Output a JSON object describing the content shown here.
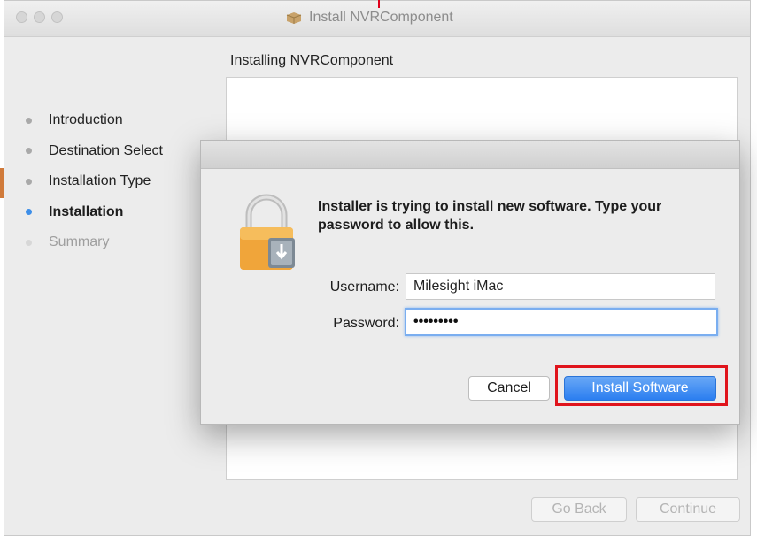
{
  "window": {
    "title": "Install NVRComponent",
    "section_title": "Installing NVRComponent"
  },
  "sidebar": {
    "items": [
      {
        "label": "Introduction",
        "state": "done"
      },
      {
        "label": "Destination Select",
        "state": "done"
      },
      {
        "label": "Installation Type",
        "state": "done"
      },
      {
        "label": "Installation",
        "state": "active"
      },
      {
        "label": "Summary",
        "state": "pending"
      }
    ]
  },
  "footer": {
    "go_back_label": "Go Back",
    "continue_label": "Continue"
  },
  "auth_dialog": {
    "message": "Installer is trying to install new software. Type your password to allow this.",
    "username_label": "Username:",
    "username_value": "Milesight iMac",
    "password_label": "Password:",
    "password_masked": "•••••••••",
    "cancel_label": "Cancel",
    "install_label": "Install Software"
  },
  "colors": {
    "accent": "#3d8ee8",
    "primary_button": "#2b7ef0",
    "highlight": "#e0141c"
  },
  "icons": {
    "title_icon": "package-icon",
    "dialog_icon": "padlock-installer-icon"
  }
}
